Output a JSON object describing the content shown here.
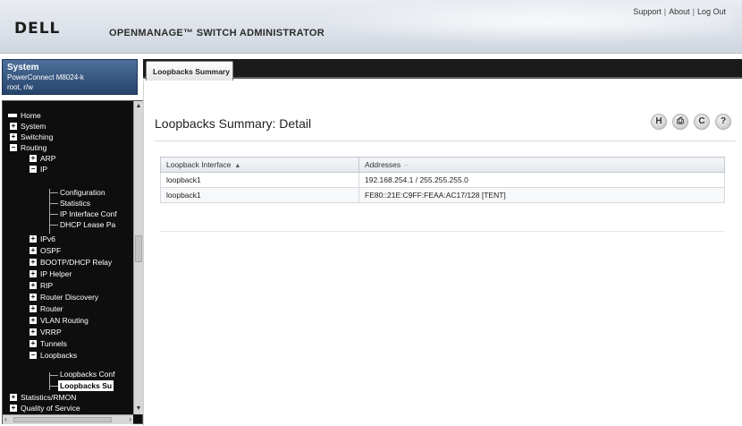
{
  "header": {
    "brand": "DELL",
    "title": "OPENMANAGE™ SWITCH ADMINISTRATOR",
    "links": [
      "Support",
      "About",
      "Log Out"
    ]
  },
  "system": {
    "title": "System",
    "model": "PowerConnect M8024-k",
    "user": "root, r/w"
  },
  "nav": {
    "items": [
      {
        "label": "Home"
      },
      {
        "label": "System",
        "toggle": "+"
      },
      {
        "label": "Switching",
        "toggle": "+"
      },
      {
        "label": "Routing",
        "toggle": "−"
      },
      {
        "label": "ARP",
        "toggle": "+"
      },
      {
        "label": "IP",
        "toggle": "−"
      },
      {
        "label": "Configuration"
      },
      {
        "label": "Statistics"
      },
      {
        "label": "IP Interface Conf"
      },
      {
        "label": "DHCP Lease Pa"
      },
      {
        "label": "IPv6",
        "toggle": "+"
      },
      {
        "label": "OSPF",
        "toggle": "+"
      },
      {
        "label": "BOOTP/DHCP Relay",
        "toggle": "+"
      },
      {
        "label": "IP Helper",
        "toggle": "+"
      },
      {
        "label": "RIP",
        "toggle": "+"
      },
      {
        "label": "Router Discovery",
        "toggle": "+"
      },
      {
        "label": "Router",
        "toggle": "+"
      },
      {
        "label": "VLAN Routing",
        "toggle": "+"
      },
      {
        "label": "VRRP",
        "toggle": "+"
      },
      {
        "label": "Tunnels",
        "toggle": "+"
      },
      {
        "label": "Loopbacks",
        "toggle": "−"
      },
      {
        "label": "Loopbacks Conf"
      },
      {
        "label": "Loopbacks Su"
      },
      {
        "label": "Statistics/RMON",
        "toggle": "+"
      },
      {
        "label": "Quality of Service",
        "toggle": "+"
      }
    ]
  },
  "tabs": [
    {
      "label": "Loopbacks Summary"
    }
  ],
  "main": {
    "title": "Loopbacks Summary: Detail",
    "icons": [
      "H",
      "⎙",
      "C",
      "?"
    ],
    "table": {
      "columns": [
        "Loopback Interface",
        "Addresses"
      ],
      "sort_marks": [
        "▲",
        "−"
      ],
      "rows": [
        [
          "loopback1",
          "192.168.254.1 / 255.255.255.0"
        ],
        [
          "loopback1",
          "FE80::21E:C9FF:FEAA:AC17/128 [TENT]"
        ]
      ]
    }
  }
}
